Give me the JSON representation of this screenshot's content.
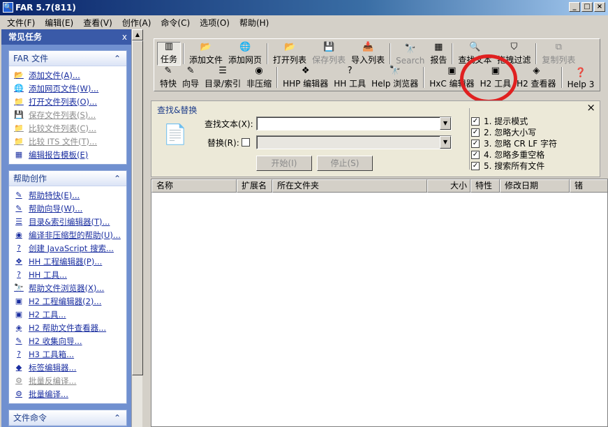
{
  "window": {
    "title": "FAR 5.7(811)",
    "icon": "magnifier-icon"
  },
  "menu": [
    "文件(F)",
    "编辑(E)",
    "查看(V)",
    "创作(A)",
    "命令(C)",
    "选项(O)",
    "帮助(H)"
  ],
  "sidebar": {
    "title": "常见任务",
    "close": "x",
    "groups": [
      {
        "title": "FAR 文件",
        "items": [
          {
            "label": "添加文件(A)...",
            "icon": "add-file-icon",
            "enabled": true
          },
          {
            "label": "添加网页文件(W)...",
            "icon": "add-web-icon",
            "enabled": true
          },
          {
            "label": "打开文件列表(O)...",
            "icon": "open-list-icon",
            "enabled": true
          },
          {
            "label": "保存文件列表(S)...",
            "icon": "save-list-icon",
            "enabled": false
          },
          {
            "label": "比较文件列表(C)...",
            "icon": "compare-list-icon",
            "enabled": false
          },
          {
            "label": "比较 ITS 文件(T)...",
            "icon": "compare-its-icon",
            "enabled": false
          },
          {
            "label": "编辑报告模板(E)",
            "icon": "report-template-icon",
            "enabled": true
          }
        ]
      },
      {
        "title": "帮助创作",
        "items": [
          {
            "label": "帮助特快(E)...",
            "icon": "wizard-icon",
            "enabled": true
          },
          {
            "label": "帮助向导(W)...",
            "icon": "wizard-icon",
            "enabled": true
          },
          {
            "label": "目录&索引编辑器(T)...",
            "icon": "toc-icon",
            "enabled": true
          },
          {
            "label": "编译非压缩型的帮助(U)...",
            "icon": "compile-icon",
            "enabled": true
          },
          {
            "label": "创建 JavaScript 搜索...",
            "icon": "question-icon",
            "enabled": true
          },
          {
            "label": "HH 工程编辑器(P)...",
            "icon": "hhp-icon",
            "enabled": true
          },
          {
            "label": "HH 工具...",
            "icon": "hh-tools-icon",
            "enabled": true
          },
          {
            "label": "帮助文件浏览器(X)...",
            "icon": "browser-icon",
            "enabled": true
          },
          {
            "label": "H2 工程编辑器(2)...",
            "icon": "h2-project-icon",
            "enabled": true
          },
          {
            "label": "H2 工具...",
            "icon": "h2-tools-icon",
            "enabled": true
          },
          {
            "label": "H2 帮助文件查看器...",
            "icon": "h2-viewer-icon",
            "enabled": true
          },
          {
            "label": "H2 收集向导...",
            "icon": "h2-collect-icon",
            "enabled": true
          },
          {
            "label": "H3 工具箱...",
            "icon": "h3-toolbox-icon",
            "enabled": true
          },
          {
            "label": "标签编辑器...",
            "icon": "tag-icon",
            "enabled": true
          },
          {
            "label": "批量反编译...",
            "icon": "batch-decompile-icon",
            "enabled": false
          },
          {
            "label": "批量编译...",
            "icon": "batch-compile-icon",
            "enabled": true
          }
        ]
      },
      {
        "title": "文件命令",
        "items": []
      }
    ]
  },
  "toolbar": {
    "row1": [
      {
        "label": "任务",
        "icon": "tasks-icon",
        "enabled": true,
        "active": true
      },
      {
        "label": "添加文件",
        "icon": "add-file-icon",
        "enabled": true
      },
      {
        "label": "添加网页",
        "icon": "add-web-icon",
        "enabled": true
      },
      {
        "label": "打开列表",
        "icon": "open-list-icon",
        "enabled": true
      },
      {
        "label": "保存列表",
        "icon": "save-icon",
        "enabled": false
      },
      {
        "label": "导入列表",
        "icon": "import-icon",
        "enabled": true
      },
      {
        "label": "Search",
        "icon": "search-icon",
        "enabled": false
      },
      {
        "label": "报告",
        "icon": "report-icon",
        "enabled": true
      },
      {
        "label": "查找文本",
        "icon": "find-text-icon",
        "enabled": true
      },
      {
        "label": "拖拽过滤",
        "icon": "drag-filter-icon",
        "enabled": true
      },
      {
        "label": "复制列表",
        "icon": "copy-list-icon",
        "enabled": false
      }
    ],
    "row2": [
      {
        "label": "特快",
        "icon": "express-icon",
        "enabled": true
      },
      {
        "label": "向导",
        "icon": "wizard-icon",
        "enabled": true
      },
      {
        "label": "目录/索引",
        "icon": "toc-icon",
        "enabled": true
      },
      {
        "label": "非压缩",
        "icon": "uncompressed-icon",
        "enabled": true
      },
      {
        "label": "HHP 编辑器",
        "icon": "hhp-icon",
        "enabled": true
      },
      {
        "label": "HH 工具",
        "icon": "hh-tools-icon",
        "enabled": true
      },
      {
        "label": "Help 浏览器",
        "icon": "browser-icon",
        "enabled": true
      },
      {
        "label": "HxC 编辑器",
        "icon": "hxc-icon",
        "enabled": true
      },
      {
        "label": "H2 工具",
        "icon": "h2-tools-icon",
        "enabled": true
      },
      {
        "label": "H2 查看器",
        "icon": "h2-viewer-icon",
        "enabled": true
      },
      {
        "label": "Help 3",
        "icon": "help3-icon",
        "enabled": true
      }
    ]
  },
  "find": {
    "title": "查找&替换",
    "close": "×",
    "find_label": "查找文本(X):",
    "find_value": "",
    "replace_label": "替换(R):",
    "replace_checked": false,
    "replace_value": "",
    "start_button": "开始(I)",
    "stop_button": "停止(S)",
    "options": [
      {
        "label": "1. 提示模式",
        "checked": true
      },
      {
        "label": "2. 忽略大小写",
        "checked": true
      },
      {
        "label": "3. 忽略 CR LF 字符",
        "checked": true
      },
      {
        "label": "4. 忽略多重空格",
        "checked": true
      },
      {
        "label": "5. 搜索所有文件",
        "checked": true
      }
    ]
  },
  "results": {
    "columns": [
      "名称",
      "扩展名",
      "所在文件夹",
      "大小",
      "特性",
      "修改日期",
      "锗"
    ],
    "rows": []
  },
  "colors": {
    "accent": "#0a246a",
    "link": "#1a2ea0",
    "highlight_circle": "#e02020"
  }
}
